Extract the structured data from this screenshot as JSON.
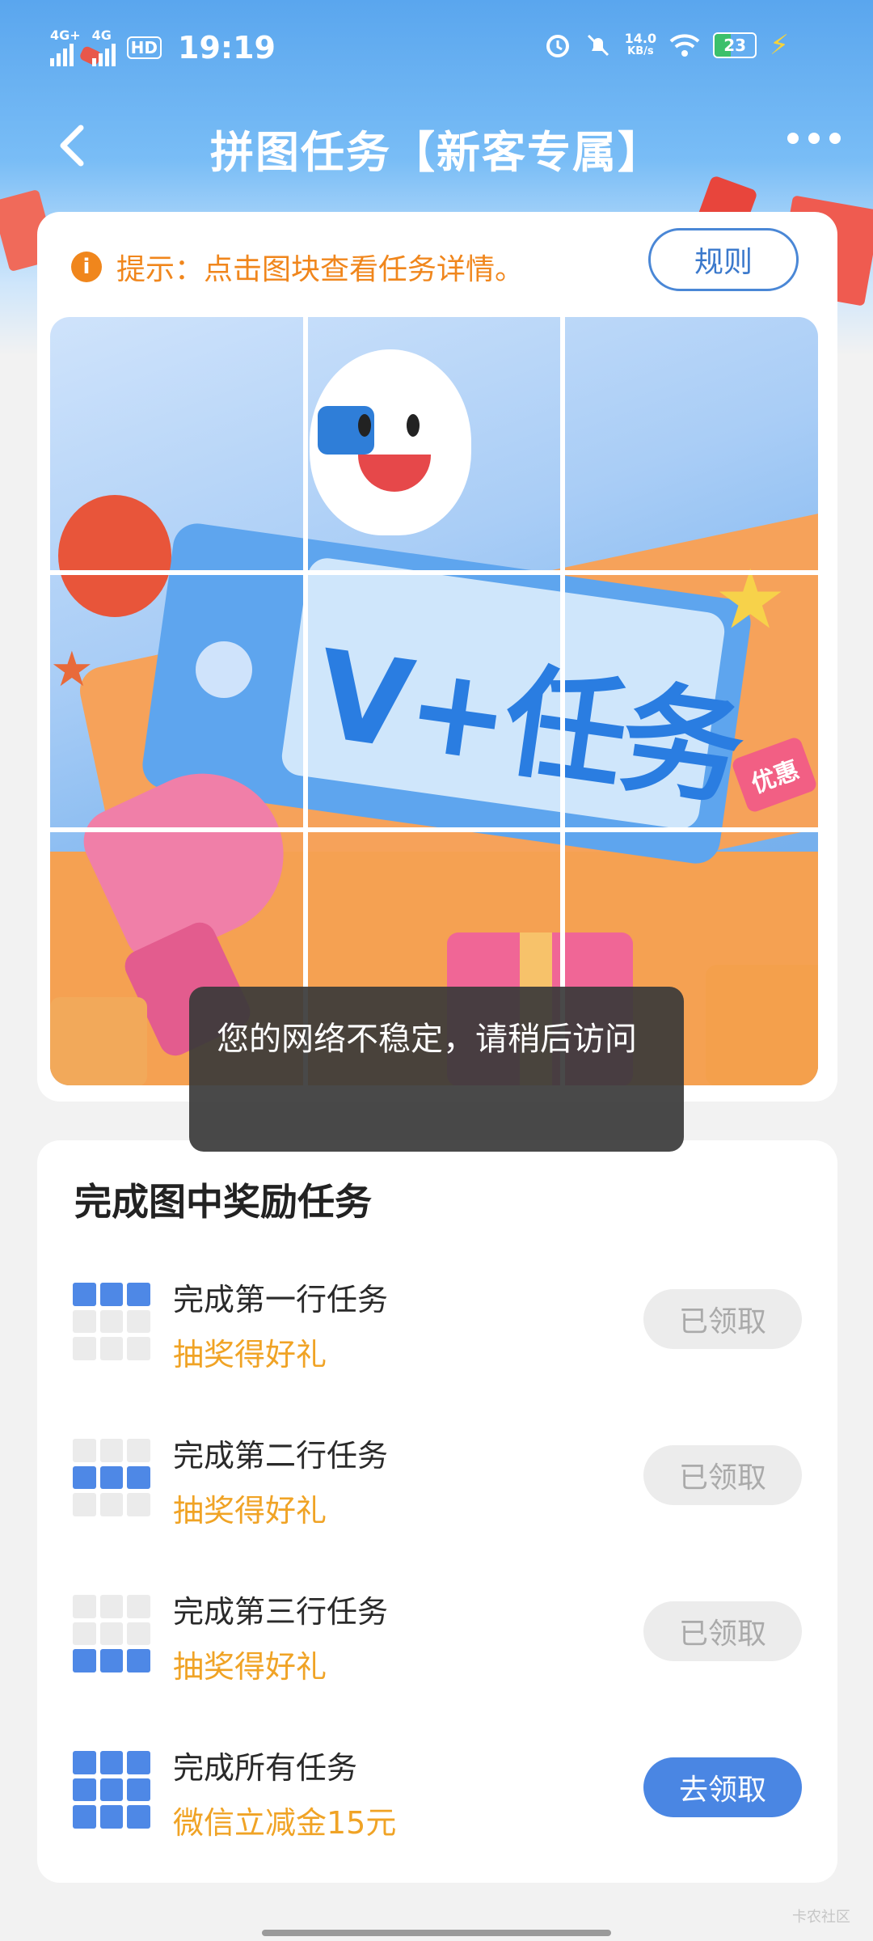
{
  "status_bar": {
    "network1": "4G+",
    "network2": "4G",
    "hd": "HD",
    "time": "19:19",
    "net_speed_value": "14.0",
    "net_speed_unit": "KB/s",
    "battery": "23"
  },
  "nav": {
    "title": "拼图任务【新客专属】"
  },
  "puzzle": {
    "tip": "提示：点击图块查看任务详情。",
    "tip_icon": "i",
    "rules_label": "规则",
    "image_text": "V+任务",
    "image_tag": "优惠"
  },
  "toast": {
    "message": "您的网络不稳定，请稍后访问"
  },
  "tasks": {
    "title": "完成图中奖励任务",
    "items": [
      {
        "name": "完成第一行任务",
        "reward": "抽奖得好礼",
        "button": "已领取",
        "state": "done",
        "rows": [
          1
        ]
      },
      {
        "name": "完成第二行任务",
        "reward": "抽奖得好礼",
        "button": "已领取",
        "state": "done",
        "rows": [
          2
        ]
      },
      {
        "name": "完成第三行任务",
        "reward": "抽奖得好礼",
        "button": "已领取",
        "state": "done",
        "rows": [
          3
        ]
      },
      {
        "name": "完成所有任务",
        "reward": "微信立减金15元",
        "button": "去领取",
        "state": "active",
        "rows": [
          1,
          2,
          3
        ]
      }
    ]
  },
  "watermark": "卡农社区",
  "colors": {
    "accent_blue": "#4a86e3",
    "tip_orange": "#f0861c",
    "reward_yellow": "#f0a325"
  }
}
